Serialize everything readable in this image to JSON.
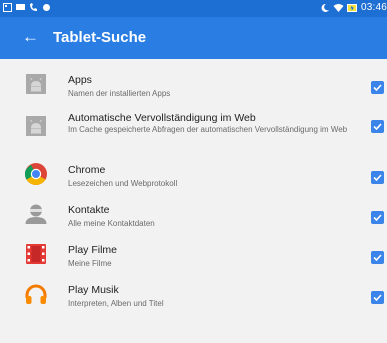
{
  "status_bar": {
    "time": "03:46",
    "left_icons": [
      "notification-icon",
      "screen-icon",
      "phone-icon",
      "record-icon"
    ],
    "right_icons": [
      "moon-icon",
      "wifi-icon",
      "battery-icon"
    ]
  },
  "app_bar": {
    "title": "Tablet-Suche"
  },
  "colors": {
    "status_bar": "#1e6fd3",
    "app_bar": "#2a7ee3",
    "checkbox": "#3a84ea",
    "background": "#f2f2f2"
  },
  "items": [
    {
      "title": "Apps",
      "subtitle": "Namen der installierten Apps",
      "icon": "android-apps-icon",
      "checked": true
    },
    {
      "title": "Automatische Vervollständigung im Web",
      "subtitle": "Im Cache gespeicherte Abfragen der automatischen Vervollständigung im Web",
      "icon": "android-autocomplete-icon",
      "checked": true
    },
    {
      "title": "Chrome",
      "subtitle": "Lesezeichen und Webprotokoll",
      "icon": "chrome-icon",
      "checked": true
    },
    {
      "title": "Kontakte",
      "subtitle": "Alle meine Kontaktdaten",
      "icon": "contacts-icon",
      "checked": true
    },
    {
      "title": "Play Filme",
      "subtitle": "Meine Filme",
      "icon": "play-movies-icon",
      "checked": true
    },
    {
      "title": "Play Musik",
      "subtitle": "Interpreten, Alben und Titel",
      "icon": "play-music-icon",
      "checked": true
    }
  ]
}
